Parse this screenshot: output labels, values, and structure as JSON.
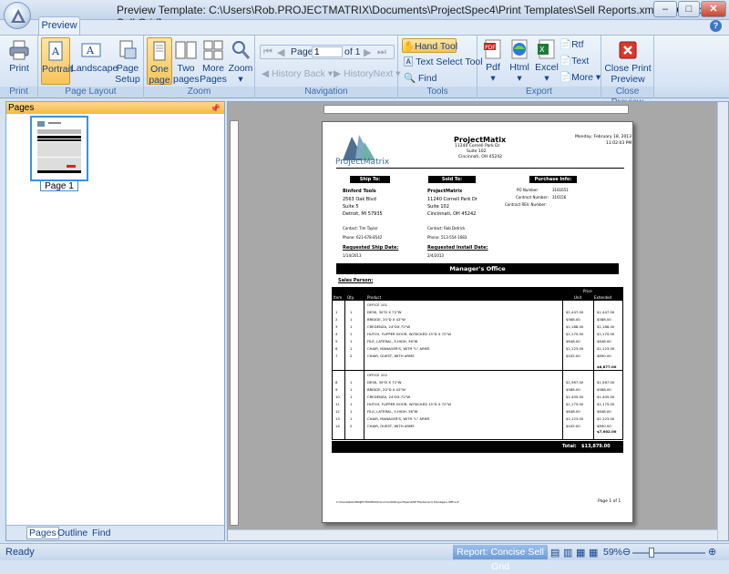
{
  "window": {
    "title": "Preview Template:  C:\\Users\\Rob.PROJECTMATRIX\\Documents\\ProjectSpec4\\Print Templates\\Sell Reports.xml * - [Concise Sell Grid]",
    "minimize": "–",
    "maximize": "□",
    "close": "✕"
  },
  "ribbon": {
    "tab": "Preview",
    "groups": {
      "print": "Print",
      "layout": "Page Layout",
      "zoom": "Zoom",
      "navigation": "Navigation",
      "tools": "Tools",
      "export": "Export",
      "close": "Close Preview"
    },
    "print": {
      "print": "Print"
    },
    "layout": {
      "portrait": "Portrait",
      "landscape": "Landscape",
      "page_setup_1": "Page",
      "page_setup_2": "Setup"
    },
    "zoom": {
      "one_page_1": "One",
      "one_page_2": "page",
      "two_pages_1": "Two",
      "two_pages_2": "pages",
      "more_pages_1": "More",
      "more_pages_2": "Pages",
      "zoom": "Zoom"
    },
    "navigation": {
      "page_label": "Page",
      "page_value": "1",
      "of_label": "of 1",
      "history_back": "History Back",
      "history_next": "HistoryNext"
    },
    "tools": {
      "hand": "Hand Tool",
      "text_select": "Text Select Tool",
      "find": "Find"
    },
    "export": {
      "pdf": "Pdf",
      "html": "Html",
      "excel": "Excel",
      "rtf": "Rtf",
      "text": "Text",
      "more": "More"
    },
    "close": {
      "line1": "Close Print",
      "line2": "Preview"
    }
  },
  "sidepanel": {
    "title": "Pages",
    "thumb_label": "Page 1",
    "tabs": [
      "Pages",
      "Outline",
      "Find"
    ]
  },
  "status": {
    "text": "Ready",
    "report": "Report: Concise Sell Grid",
    "zoom": "59%"
  },
  "report": {
    "company": "ProjectMatix",
    "addr1": "11240 Cornell Park Dr",
    "addr2": "Suite 102",
    "addr3": "Cincinnati, OH 45242",
    "date": "Monday, February 18, 2013",
    "time": "11:02:03 PM",
    "logo_text": "ProjectMatrix",
    "ship_to": "Ship To:",
    "sold_to": "Sold To:",
    "purchase_info": "Purchase Info:",
    "ship": {
      "name": "Binford Tools",
      "a1": "2563 Oak Blvd",
      "a2": "Suite 5",
      "a3": "Detroit, MI 57935",
      "contact": "Contact: Tim Taylor",
      "phone": "Phone:   621-678-8542"
    },
    "sold": {
      "name": "ProjectMatrix",
      "a1": "11240 Cornell Park Dr",
      "a2": "Suite 102",
      "a3": "Cincinnati, OH 45242",
      "contact": "Contact: Rob Detrick",
      "phone": "Phone:   513-554-1683"
    },
    "purchase": {
      "po_label": "PO Number:",
      "po": "3161651",
      "contract_label": "Contract Number:",
      "contract": "316156",
      "contract_rev": "Contract REV. Number:"
    },
    "req_ship_label": "Requested Ship Date:",
    "req_ship": "1/14/2013",
    "req_install_label": "Requested Install Date:",
    "req_install": "2/4/2013",
    "section": "Manager's Office",
    "sales_person": "Sales Person:",
    "cols": {
      "item": "Item",
      "qty": "Qty.",
      "product": "Product",
      "price": "Price",
      "unit": "Unit",
      "extended": "Extended"
    },
    "group1": {
      "title": "OFFICE 101",
      "rows": [
        [
          "1",
          "1",
          "DESK, 30\"D X 72\"W",
          "$1,447.00",
          "$1,447.00"
        ],
        [
          "2",
          "1",
          "BRIDGE, 20\"D X 42\"W",
          "$588.00",
          "$588.00"
        ],
        [
          "3",
          "1",
          "CREDENZA, 24\"DX 72\"W",
          "$1,188.00",
          "$1,188.00"
        ],
        [
          "4",
          "1",
          "HUTCH, FLIPPER DOOR, W/TACKED 15\"D X 72\"W",
          "$1,175.00",
          "$1,175.00"
        ],
        [
          "5",
          "1",
          "FILE, LATERAL, 3-HIGH, 36\"W",
          "$648.00",
          "$648.00"
        ],
        [
          "6",
          "1",
          "CHAIR, MANAGER'S, WITH \"L\" ARMS",
          "$1,123.00",
          "$1,123.00"
        ],
        [
          "7",
          "2",
          "CHAIR, GUEST, WITH ARMS",
          "$445.00",
          "$890.00"
        ]
      ],
      "subtotal": "$6,877.00"
    },
    "group2": {
      "title": "OFFICE 102",
      "rows": [
        [
          "8",
          "1",
          "DESK, 30\"D X 72\"W",
          "$1,567.00",
          "$1,567.00"
        ],
        [
          "9",
          "1",
          "BRIDGE, 20\"D X 42\"W",
          "$588.00",
          "$588.00"
        ],
        [
          "10",
          "1",
          "CREDENZA, 24\"DX 72\"W",
          "$1,405.00",
          "$1,405.00"
        ],
        [
          "11",
          "1",
          "HUTCH, FLIPPER DOOR, W/TACKED 15\"D X 72\"W",
          "$1,175.00",
          "$1,175.00"
        ],
        [
          "12",
          "1",
          "FILE, LATERAL, 3-HIGH, 36\"W",
          "$648.00",
          "$648.00"
        ],
        [
          "13",
          "1",
          "CHAIR, MANAGER'S, WITH \"L\" ARMS",
          "$1,123.00",
          "$1,123.00"
        ],
        [
          "14",
          "2",
          "CHAIR, GUEST, WITH ARMS",
          "$445.00",
          "$890.00"
        ]
      ],
      "subtotal": "$7,002.00"
    },
    "total_label": "Total:",
    "total": "$13,879.00",
    "footer_path": "C:\\Users\\Rob.PROJECTMATRIX\\Documents\\ProjectSpec4\\SP File\\Generic Managers Office.P",
    "footer_page": "Page 1 of 1"
  }
}
